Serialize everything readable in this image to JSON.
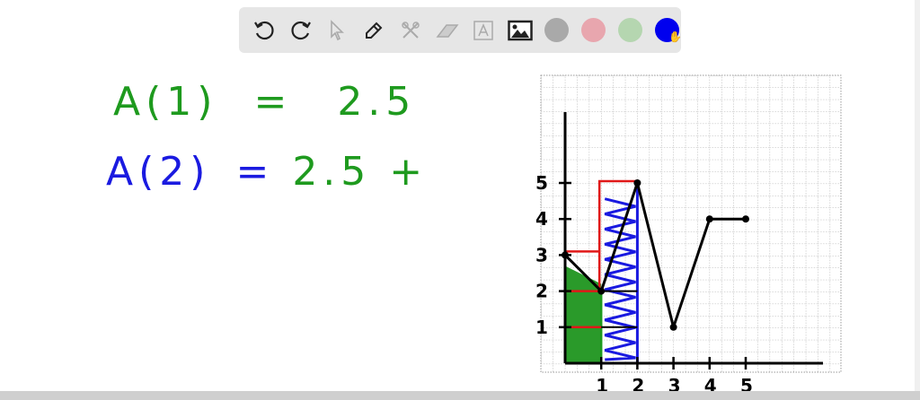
{
  "toolbar": {
    "tools": [
      "undo-icon",
      "redo-icon",
      "select-icon",
      "pen-icon",
      "tools-icon",
      "eraser-icon",
      "text-icon",
      "image-icon"
    ],
    "colors": [
      "#a9a9a9",
      "#e8a6ae",
      "#b5d6b0",
      "#0000ee"
    ],
    "selected_color": "#0000ee"
  },
  "board": {
    "line1": {
      "lhs": "A(1)",
      "eq": "=",
      "rhs": "2.5",
      "color": "#1e9a1e"
    },
    "line2": {
      "lhs": "A(2)",
      "eq": "=",
      "rhs": "2.5 +",
      "lhs_color": "#1a1ae0",
      "rhs_color": "#1e9a1e"
    },
    "graph": {
      "x_ticks": [
        "1",
        "2",
        "3",
        "4",
        "5"
      ],
      "y_ticks": [
        "1",
        "2",
        "3",
        "4",
        "5"
      ],
      "points": [
        [
          0,
          3
        ],
        [
          1,
          2
        ],
        [
          2,
          5
        ],
        [
          3,
          1
        ],
        [
          4,
          4
        ],
        [
          5,
          4
        ]
      ]
    }
  }
}
